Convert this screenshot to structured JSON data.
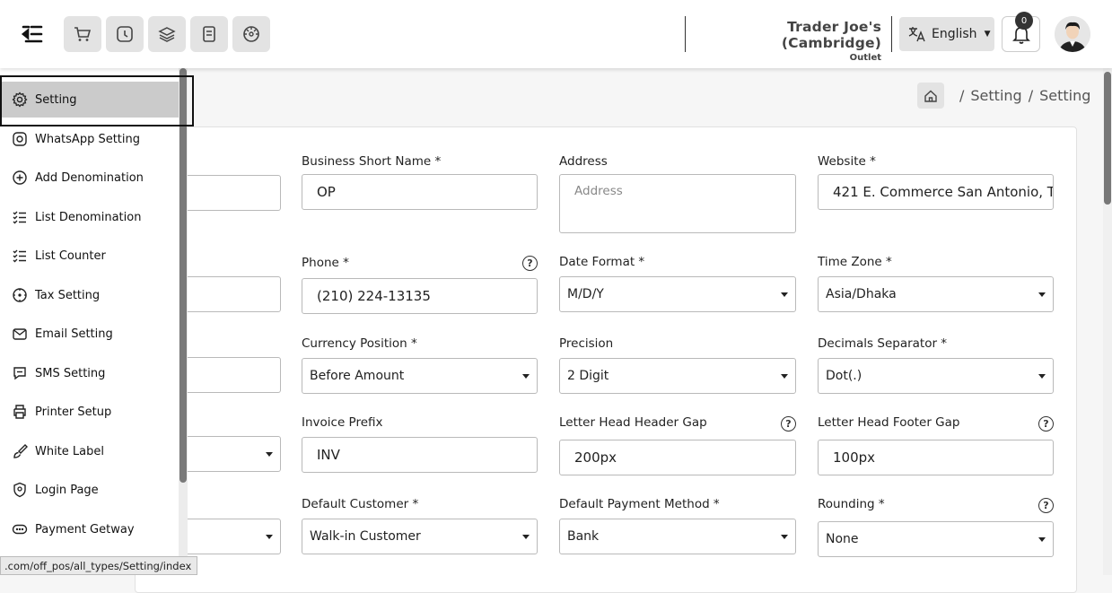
{
  "header": {
    "outlet_name": "Trader Joe's (Cambridge)",
    "outlet_label": "Outlet",
    "language": "English",
    "notification_count": "0",
    "toolbar_icons": [
      "cart-icon",
      "clock-icon",
      "layers-icon",
      "receipt-icon",
      "dashboard-icon"
    ]
  },
  "breadcrumb": {
    "items": [
      "Setting",
      "Setting"
    ],
    "separator": "/"
  },
  "sidebar": {
    "items": [
      {
        "label": "Setting",
        "icon": "gear-icon",
        "active": true
      },
      {
        "label": "WhatsApp Setting",
        "icon": "whatsapp-icon"
      },
      {
        "label": "Add Denomination",
        "icon": "plus-circle-icon"
      },
      {
        "label": "List Denomination",
        "icon": "list-icon"
      },
      {
        "label": "List Counter",
        "icon": "list-icon"
      },
      {
        "label": "Tax Setting",
        "icon": "tax-icon"
      },
      {
        "label": "Email Setting",
        "icon": "email-icon"
      },
      {
        "label": "SMS Setting",
        "icon": "sms-icon"
      },
      {
        "label": "Printer Setup",
        "icon": "printer-icon"
      },
      {
        "label": "White Label",
        "icon": "brush-icon"
      },
      {
        "label": "Login Page",
        "icon": "shield-icon"
      },
      {
        "label": "Payment Getway",
        "icon": "payment-icon"
      }
    ]
  },
  "status_url": ".com/off_pos/all_types/Setting/index",
  "form": {
    "business_short_name": {
      "label": "Business Short Name *",
      "value": "OP"
    },
    "address": {
      "label": "Address",
      "placeholder": "Address"
    },
    "website": {
      "label": "Website *",
      "value": "421 E. Commerce San Antonio, T..."
    },
    "phone": {
      "label": "Phone *",
      "value": "(210) 224-13135"
    },
    "date_format": {
      "label": "Date Format *",
      "value": "M/D/Y"
    },
    "time_zone": {
      "label": "Time Zone *",
      "value": "Asia/Dhaka"
    },
    "currency_position": {
      "label": "Currency Position *",
      "value": "Before Amount"
    },
    "precision": {
      "label": "Precision",
      "value": "2 Digit"
    },
    "decimals_separator": {
      "label": "Decimals Separator *",
      "value": "Dot(.)"
    },
    "invoice_prefix": {
      "label": "Invoice Prefix",
      "value": "INV"
    },
    "letter_head_header_gap": {
      "label": "Letter Head Header Gap",
      "value": "200px"
    },
    "letter_head_footer_gap": {
      "label": "Letter Head Footer Gap",
      "value": "100px"
    },
    "default_customer": {
      "label": "Default Customer *",
      "value": "Walk-in Customer"
    },
    "default_payment_method": {
      "label": "Default Payment Method *",
      "value": "Bank"
    },
    "rounding": {
      "label": "Rounding *",
      "value": "None"
    },
    "help_glyph": "?"
  }
}
